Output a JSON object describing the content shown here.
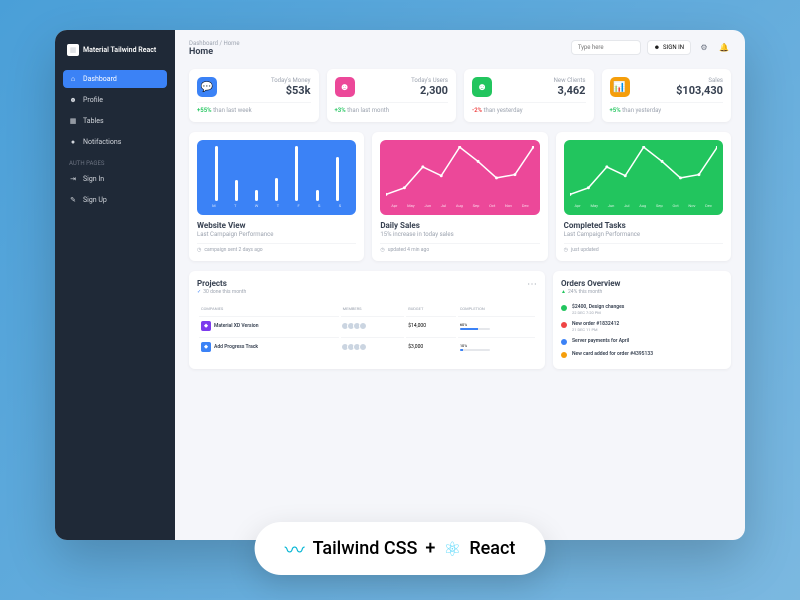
{
  "sidebar": {
    "logo": "Material Tailwind React",
    "nav": [
      {
        "label": "Dashboard",
        "icon": "⌂"
      },
      {
        "label": "Profile",
        "icon": "☻"
      },
      {
        "label": "Tables",
        "icon": "▦"
      },
      {
        "label": "Notifactions",
        "icon": "●"
      }
    ],
    "auth_section": "Auth Pages",
    "auth": [
      {
        "label": "Sign In",
        "icon": "⇥"
      },
      {
        "label": "Sign Up",
        "icon": "✎"
      }
    ]
  },
  "header": {
    "breadcrumb": "Dashboard / Home",
    "title": "Home",
    "search_placeholder": "Type here",
    "signin": "SIGN IN"
  },
  "stats": [
    {
      "icon_color": "blue",
      "label": "Today's Money",
      "value": "$53k",
      "change_pct": "+55%",
      "change_text": "than last week",
      "positive": true
    },
    {
      "icon_color": "pink",
      "label": "Today's Users",
      "value": "2,300",
      "change_pct": "+3%",
      "change_text": "than last month",
      "positive": true
    },
    {
      "icon_color": "green",
      "label": "New Clients",
      "value": "3,462",
      "change_pct": "-2%",
      "change_text": "than yesterday",
      "positive": false
    },
    {
      "icon_color": "orange",
      "label": "Sales",
      "value": "$103,430",
      "change_pct": "+5%",
      "change_text": "than yesterday",
      "positive": true
    }
  ],
  "chart_data": [
    {
      "type": "bar",
      "title": "Website View",
      "subtitle": "Last Campaign Performance",
      "meta": "campaign sent 2 days ago",
      "categories": [
        "M",
        "T",
        "W",
        "T",
        "F",
        "S",
        "S"
      ],
      "values": [
        48,
        18,
        10,
        20,
        48,
        10,
        38
      ],
      "ylim": [
        0,
        50
      ],
      "color": "blue"
    },
    {
      "type": "line",
      "title": "Daily Sales",
      "subtitle": "15% increase in today sales",
      "meta": "updated 4 min ago",
      "categories": [
        "Apr",
        "May",
        "Jun",
        "Jul",
        "Aug",
        "Sep",
        "Oct",
        "Nov",
        "Dec"
      ],
      "values": [
        60,
        120,
        310,
        230,
        490,
        360,
        210,
        240,
        490
      ],
      "ylim": [
        0,
        500
      ],
      "color": "pink"
    },
    {
      "type": "line",
      "title": "Completed Tasks",
      "subtitle": "Last Campaign Performance",
      "meta": "just updated",
      "categories": [
        "Apr",
        "May",
        "Jun",
        "Jul",
        "Aug",
        "Sep",
        "Oct",
        "Nov",
        "Dec"
      ],
      "values": [
        60,
        120,
        310,
        230,
        490,
        360,
        210,
        240,
        490
      ],
      "ylim": [
        0,
        500
      ],
      "color": "green"
    }
  ],
  "projects": {
    "title": "Projects",
    "subtitle": "30 done this month",
    "columns": [
      "Companies",
      "Members",
      "Budget",
      "Completion"
    ],
    "rows": [
      {
        "name": "Material XD Version",
        "icon_bg": "#7c3aed",
        "budget": "$14,000",
        "completion": 60
      },
      {
        "name": "Add Progress Track",
        "icon_bg": "#3b82f6",
        "budget": "$3,000",
        "completion": 10
      }
    ]
  },
  "orders": {
    "title": "Orders Overview",
    "subtitle": "24% this month",
    "items": [
      {
        "color": "#22c55e",
        "title": "$2400, Design changes",
        "date": "22 DEC 7:20 PM"
      },
      {
        "color": "#ef4444",
        "title": "New order #1832412",
        "date": "21 DEC 11 PM"
      },
      {
        "color": "#3b82f6",
        "title": "Server payments for April",
        "date": ""
      },
      {
        "color": "#f59e0b",
        "title": "New card added for order #4395133",
        "date": ""
      }
    ]
  },
  "footer": {
    "tailwind": "Tailwind CSS",
    "plus": "+",
    "react": "React"
  }
}
